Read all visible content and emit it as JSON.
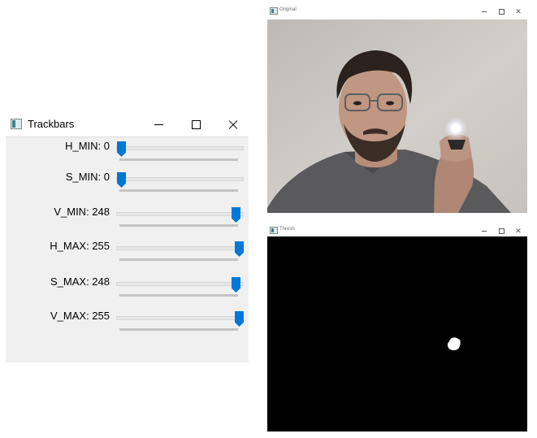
{
  "trackbars_window": {
    "title": "Trackbars",
    "controls": {
      "minimize": "minimize",
      "maximize": "maximize",
      "close": "close"
    },
    "trackbars": [
      {
        "label": "H_MIN: 0",
        "name": "H_MIN",
        "value": 0,
        "max": 255
      },
      {
        "label": "S_MIN: 0",
        "name": "S_MIN",
        "value": 0,
        "max": 255
      },
      {
        "label": "V_MIN: 248",
        "name": "V_MIN",
        "value": 248,
        "max": 255
      },
      {
        "label": "H_MAX: 255",
        "name": "H_MAX",
        "value": 255,
        "max": 255
      },
      {
        "label": "S_MAX: 248",
        "name": "S_MAX",
        "value": 248,
        "max": 255
      },
      {
        "label": "V_MAX: 255",
        "name": "V_MAX",
        "value": 255,
        "max": 255
      }
    ],
    "accent_color": "#0078d7"
  },
  "original_window": {
    "title": "Original",
    "icons": [
      "window-app-icon",
      "minimize-icon",
      "maximize-icon",
      "close-icon"
    ]
  },
  "thresh_window": {
    "title": "Thresh",
    "background_color": "#000000",
    "blob_color": "#ffffff"
  }
}
